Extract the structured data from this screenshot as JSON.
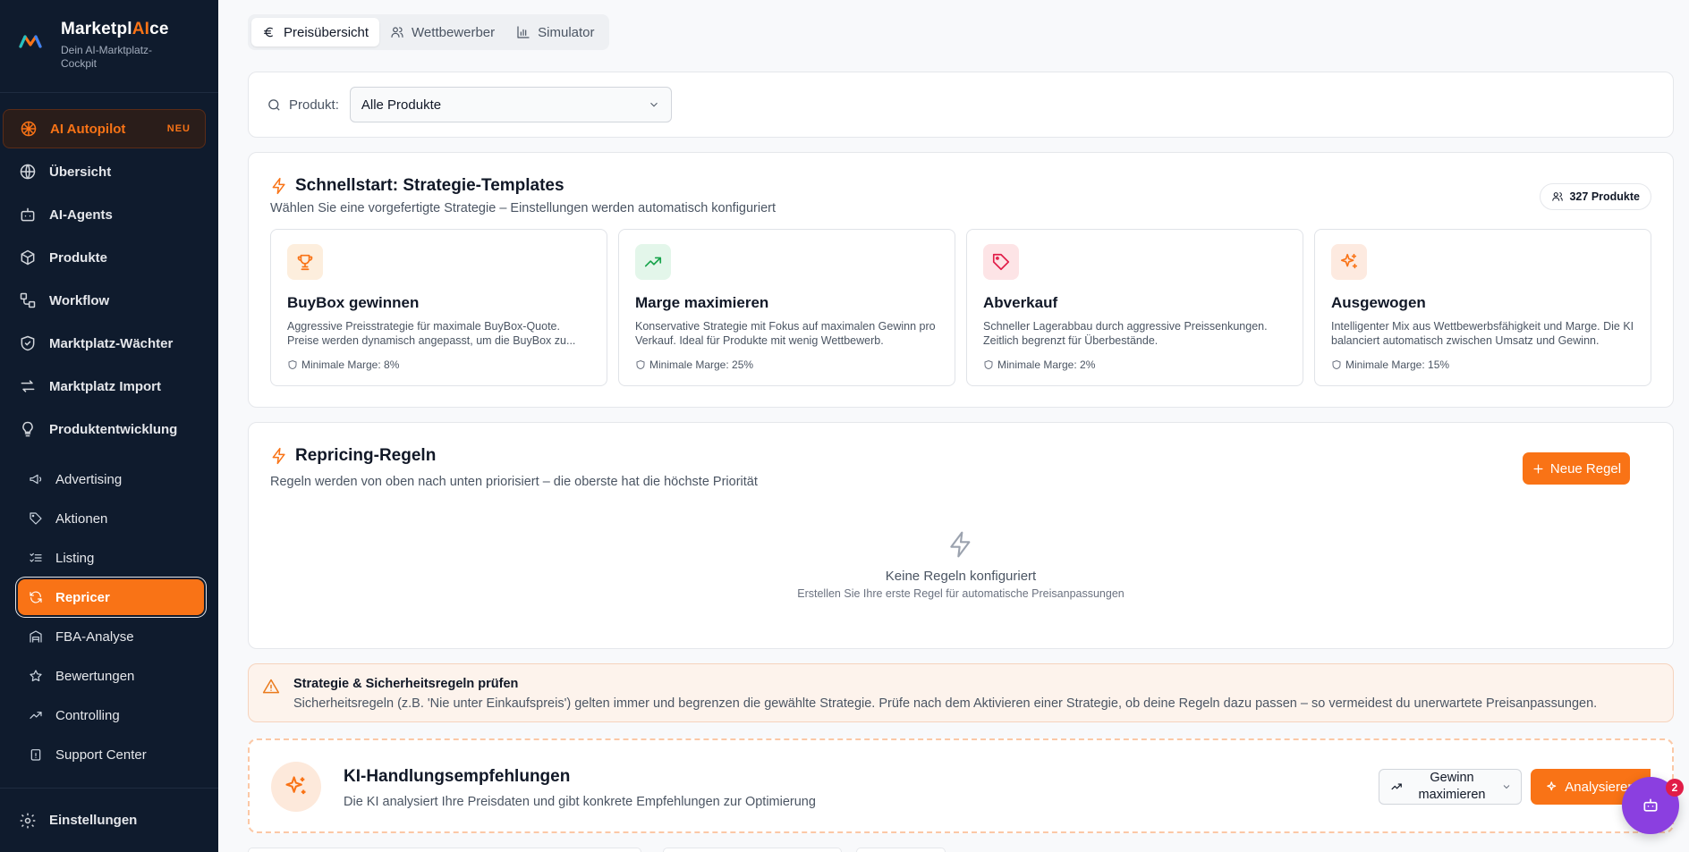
{
  "brand": {
    "name_prefix": "Marketpl",
    "name_ai": "AI",
    "name_suffix": "ce",
    "subtitle": "Dein AI-Marktplatz-Cockpit"
  },
  "nav": {
    "ai_autopilot": {
      "label": "AI Autopilot",
      "badge": "NEU"
    },
    "items": [
      {
        "label": "Übersicht",
        "icon": "globe-icon"
      },
      {
        "label": "AI-Agents",
        "icon": "bot-icon"
      },
      {
        "label": "Produkte",
        "icon": "package-icon"
      },
      {
        "label": "Workflow",
        "icon": "workflow-icon"
      },
      {
        "label": "Marktplatz-Wächter",
        "icon": "shield-icon"
      },
      {
        "label": "Marktplatz Import",
        "icon": "arrows-icon"
      },
      {
        "label": "Produktentwicklung",
        "icon": "lightbulb-icon"
      }
    ],
    "sub_items": [
      {
        "label": "Advertising",
        "icon": "megaphone-icon"
      },
      {
        "label": "Aktionen",
        "icon": "tag-icon"
      },
      {
        "label": "Listing",
        "icon": "list-checks-icon"
      },
      {
        "label": "Repricer",
        "icon": "refresh-icon"
      },
      {
        "label": "FBA-Analyse",
        "icon": "warehouse-icon"
      },
      {
        "label": "Bewertungen",
        "icon": "star-icon"
      },
      {
        "label": "Controlling",
        "icon": "trending-up-icon"
      },
      {
        "label": "Support Center",
        "icon": "clipboard-icon"
      }
    ],
    "settings": "Einstellungen"
  },
  "tabs": [
    {
      "label": "Preisübersicht",
      "icon": "euro-icon"
    },
    {
      "label": "Wettbewerber",
      "icon": "users-icon"
    },
    {
      "label": "Simulator",
      "icon": "bar-chart-icon"
    }
  ],
  "filter": {
    "label": "Produkt:",
    "value": "Alle Produkte"
  },
  "templates": {
    "title": "Schnellstart: Strategie-Templates",
    "subtitle": "Wählen Sie eine vorgefertigte Strategie – Einstellungen werden automatisch konfiguriert",
    "count": "327 Produkte",
    "cards": [
      {
        "title": "BuyBox gewinnen",
        "desc": "Aggressive Preisstrategie für maximale BuyBox-Quote. Preise werden dynamisch angepasst, um die BuyBox zu...",
        "min": "Minimale Marge: 8%",
        "color": "#f97316",
        "bg": "#fdeedd"
      },
      {
        "title": "Marge maximieren",
        "desc": "Konservative Strategie mit Fokus auf maximalen Gewinn pro Verkauf. Ideal für Produkte mit wenig Wettbewerb.",
        "min": "Minimale Marge: 25%",
        "color": "#16a34a",
        "bg": "#e3f6ea"
      },
      {
        "title": "Abverkauf",
        "desc": "Schneller Lagerabbau durch aggressive Preissenkungen. Zeitlich begrenzt für Überbestände.",
        "min": "Minimale Marge: 2%",
        "color": "#e11d48",
        "bg": "#fde4e6"
      },
      {
        "title": "Ausgewogen",
        "desc": "Intelligenter Mix aus Wettbewerbsfähigkeit und Marge. Die KI balanciert automatisch zwischen Umsatz und Gewinn.",
        "min": "Minimale Marge: 15%",
        "color": "#f97316",
        "bg": "#fdeae0"
      }
    ]
  },
  "rules": {
    "title": "Repricing-Regeln",
    "subtitle": "Regeln werden von oben nach unten priorisiert – die oberste hat die höchste Priorität",
    "new_button": "Neue Regel",
    "empty_title": "Keine Regeln konfiguriert",
    "empty_sub": "Erstellen Sie Ihre erste Regel für automatische Preisanpassungen"
  },
  "warning": {
    "title": "Strategie & Sicherheitsregeln prüfen",
    "text": "Sicherheitsregeln (z.B. 'Nie unter Einkaufspreis') gelten immer und begrenzen die gewählte Strategie. Prüfe nach dem Aktivieren einer Strategie, ob deine Regeln dazu passen – so vermeidest du unerwartete Preisanpassungen."
  },
  "ki": {
    "title": "KI-Handlungsempfehlungen",
    "subtitle": "Die KI analysiert Ihre Preisdaten und gibt konkrete Empfehlungen zur Optimierung",
    "goal_line1": "Gewinn",
    "goal_line2": "maximieren",
    "analyze_button": "Analysieren"
  },
  "bot": {
    "badge": "2"
  },
  "colors": {
    "accent": "#f97316",
    "sidebar": "#0f1b2d",
    "bot": "#8b3fe0"
  }
}
